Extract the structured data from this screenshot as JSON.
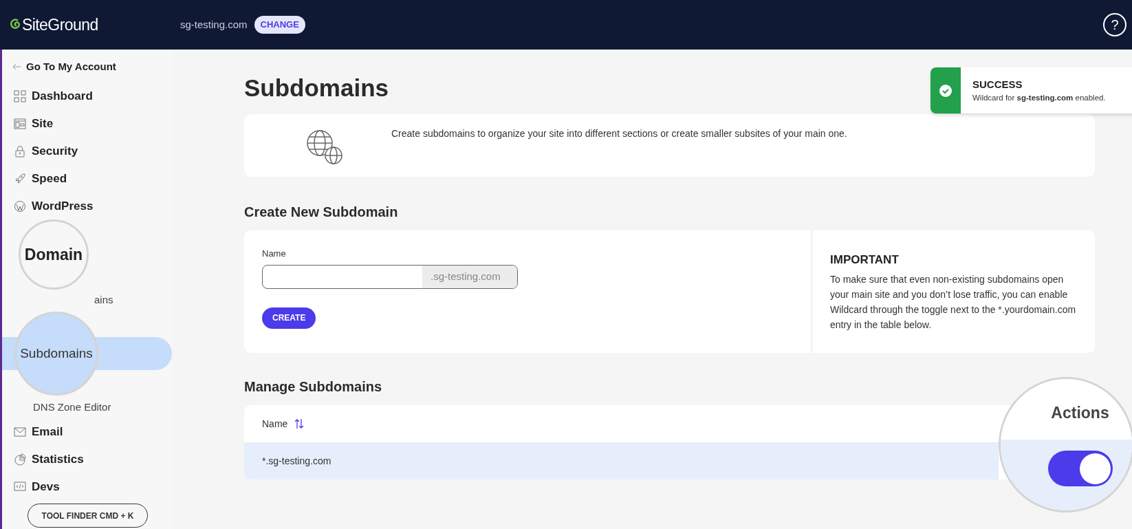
{
  "header": {
    "logo": "SiteGround",
    "site": "sg-testing.com",
    "change_button": "CHANGE",
    "help": "?"
  },
  "sidebar": {
    "back": "Go To My Account",
    "items": [
      {
        "kind": "main",
        "label": "Dashboard",
        "selected": false
      },
      {
        "kind": "main",
        "label": "Site",
        "selected": false
      },
      {
        "kind": "main",
        "label": "Security",
        "selected": false
      },
      {
        "kind": "main",
        "label": "Speed",
        "selected": false
      },
      {
        "kind": "main",
        "label": "WordPress",
        "selected": false
      },
      {
        "kind": "lens",
        "label": "Domain",
        "selected": false
      },
      {
        "kind": "sub",
        "label": "ains",
        "selected": false
      },
      {
        "kind": "sublens",
        "label": "Subdomains",
        "selected": true
      },
      {
        "kind": "sub",
        "label": "DNS Zone Editor",
        "selected": false
      },
      {
        "kind": "main",
        "label": "Email",
        "selected": false
      },
      {
        "kind": "main",
        "label": "Statistics",
        "selected": false
      },
      {
        "kind": "main",
        "label": "Devs",
        "selected": false
      }
    ],
    "tool_finder": "TOOL FINDER CMD + K"
  },
  "toast": {
    "title": "SUCCESS",
    "message": "Wildcard for **sg-testing.com** enabled."
  },
  "page_title": "Subdomains",
  "intro": "Create subdomains to organize your site into different sections or create smaller subsites of your main one.",
  "create": {
    "title": "Create New Subdomain",
    "field_label": "Name",
    "suffix": ".sg-testing.com",
    "button": "CREATE",
    "important_title": "IMPORTANT",
    "important_text": "To make sure that even non-existing subdomains open your main site and you don’t lose traffic, you can enable Wildcard through the toggle next to the *.yourdomain.com entry in the table below."
  },
  "manage": {
    "title": "Manage Subdomains",
    "columns": [
      "Name",
      "Actions"
    ],
    "rows": [
      {
        "name": "*.sg-testing.com",
        "wildcard_on": true,
        "selected": true
      }
    ]
  }
}
